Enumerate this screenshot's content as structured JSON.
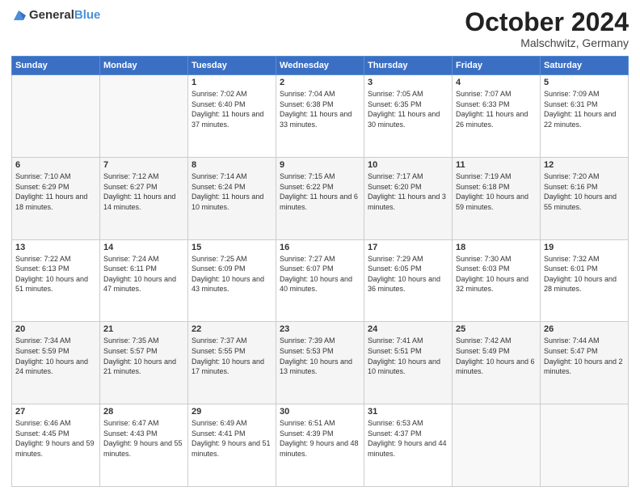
{
  "header": {
    "logo_general": "General",
    "logo_blue": "Blue",
    "month": "October 2024",
    "location": "Malschwitz, Germany"
  },
  "weekdays": [
    "Sunday",
    "Monday",
    "Tuesday",
    "Wednesday",
    "Thursday",
    "Friday",
    "Saturday"
  ],
  "weeks": [
    [
      {
        "day": "",
        "info": ""
      },
      {
        "day": "",
        "info": ""
      },
      {
        "day": "1",
        "info": "Sunrise: 7:02 AM\nSunset: 6:40 PM\nDaylight: 11 hours and 37 minutes."
      },
      {
        "day": "2",
        "info": "Sunrise: 7:04 AM\nSunset: 6:38 PM\nDaylight: 11 hours and 33 minutes."
      },
      {
        "day": "3",
        "info": "Sunrise: 7:05 AM\nSunset: 6:35 PM\nDaylight: 11 hours and 30 minutes."
      },
      {
        "day": "4",
        "info": "Sunrise: 7:07 AM\nSunset: 6:33 PM\nDaylight: 11 hours and 26 minutes."
      },
      {
        "day": "5",
        "info": "Sunrise: 7:09 AM\nSunset: 6:31 PM\nDaylight: 11 hours and 22 minutes."
      }
    ],
    [
      {
        "day": "6",
        "info": "Sunrise: 7:10 AM\nSunset: 6:29 PM\nDaylight: 11 hours and 18 minutes."
      },
      {
        "day": "7",
        "info": "Sunrise: 7:12 AM\nSunset: 6:27 PM\nDaylight: 11 hours and 14 minutes."
      },
      {
        "day": "8",
        "info": "Sunrise: 7:14 AM\nSunset: 6:24 PM\nDaylight: 11 hours and 10 minutes."
      },
      {
        "day": "9",
        "info": "Sunrise: 7:15 AM\nSunset: 6:22 PM\nDaylight: 11 hours and 6 minutes."
      },
      {
        "day": "10",
        "info": "Sunrise: 7:17 AM\nSunset: 6:20 PM\nDaylight: 11 hours and 3 minutes."
      },
      {
        "day": "11",
        "info": "Sunrise: 7:19 AM\nSunset: 6:18 PM\nDaylight: 10 hours and 59 minutes."
      },
      {
        "day": "12",
        "info": "Sunrise: 7:20 AM\nSunset: 6:16 PM\nDaylight: 10 hours and 55 minutes."
      }
    ],
    [
      {
        "day": "13",
        "info": "Sunrise: 7:22 AM\nSunset: 6:13 PM\nDaylight: 10 hours and 51 minutes."
      },
      {
        "day": "14",
        "info": "Sunrise: 7:24 AM\nSunset: 6:11 PM\nDaylight: 10 hours and 47 minutes."
      },
      {
        "day": "15",
        "info": "Sunrise: 7:25 AM\nSunset: 6:09 PM\nDaylight: 10 hours and 43 minutes."
      },
      {
        "day": "16",
        "info": "Sunrise: 7:27 AM\nSunset: 6:07 PM\nDaylight: 10 hours and 40 minutes."
      },
      {
        "day": "17",
        "info": "Sunrise: 7:29 AM\nSunset: 6:05 PM\nDaylight: 10 hours and 36 minutes."
      },
      {
        "day": "18",
        "info": "Sunrise: 7:30 AM\nSunset: 6:03 PM\nDaylight: 10 hours and 32 minutes."
      },
      {
        "day": "19",
        "info": "Sunrise: 7:32 AM\nSunset: 6:01 PM\nDaylight: 10 hours and 28 minutes."
      }
    ],
    [
      {
        "day": "20",
        "info": "Sunrise: 7:34 AM\nSunset: 5:59 PM\nDaylight: 10 hours and 24 minutes."
      },
      {
        "day": "21",
        "info": "Sunrise: 7:35 AM\nSunset: 5:57 PM\nDaylight: 10 hours and 21 minutes."
      },
      {
        "day": "22",
        "info": "Sunrise: 7:37 AM\nSunset: 5:55 PM\nDaylight: 10 hours and 17 minutes."
      },
      {
        "day": "23",
        "info": "Sunrise: 7:39 AM\nSunset: 5:53 PM\nDaylight: 10 hours and 13 minutes."
      },
      {
        "day": "24",
        "info": "Sunrise: 7:41 AM\nSunset: 5:51 PM\nDaylight: 10 hours and 10 minutes."
      },
      {
        "day": "25",
        "info": "Sunrise: 7:42 AM\nSunset: 5:49 PM\nDaylight: 10 hours and 6 minutes."
      },
      {
        "day": "26",
        "info": "Sunrise: 7:44 AM\nSunset: 5:47 PM\nDaylight: 10 hours and 2 minutes."
      }
    ],
    [
      {
        "day": "27",
        "info": "Sunrise: 6:46 AM\nSunset: 4:45 PM\nDaylight: 9 hours and 59 minutes."
      },
      {
        "day": "28",
        "info": "Sunrise: 6:47 AM\nSunset: 4:43 PM\nDaylight: 9 hours and 55 minutes."
      },
      {
        "day": "29",
        "info": "Sunrise: 6:49 AM\nSunset: 4:41 PM\nDaylight: 9 hours and 51 minutes."
      },
      {
        "day": "30",
        "info": "Sunrise: 6:51 AM\nSunset: 4:39 PM\nDaylight: 9 hours and 48 minutes."
      },
      {
        "day": "31",
        "info": "Sunrise: 6:53 AM\nSunset: 4:37 PM\nDaylight: 9 hours and 44 minutes."
      },
      {
        "day": "",
        "info": ""
      },
      {
        "day": "",
        "info": ""
      }
    ]
  ]
}
